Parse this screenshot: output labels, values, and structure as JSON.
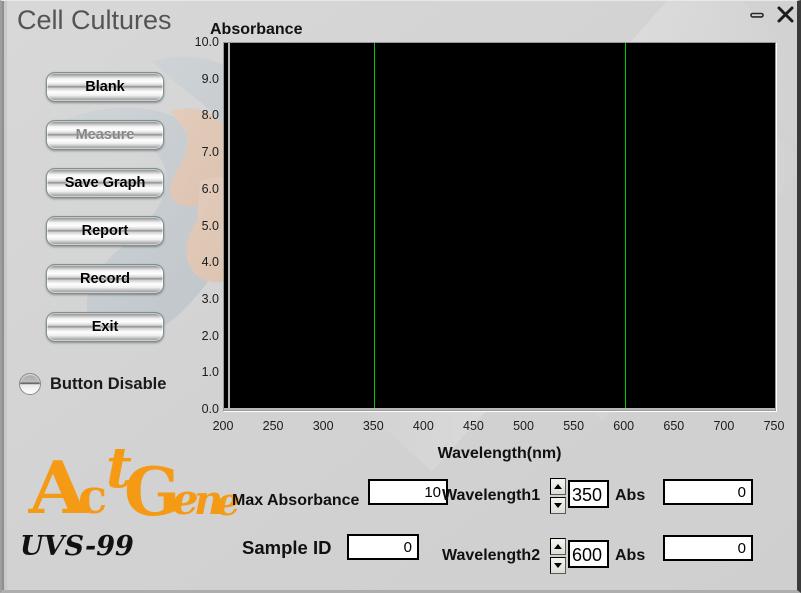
{
  "window": {
    "title": "Cell Cultures",
    "minimize_icon": "minimize-icon",
    "close_icon": "close-icon"
  },
  "sidebar": {
    "buttons": [
      {
        "label": "Blank",
        "disabled": false
      },
      {
        "label": "Measure",
        "disabled": true
      },
      {
        "label": "Save Graph",
        "disabled": false
      },
      {
        "label": "Report",
        "disabled": false
      },
      {
        "label": "Record",
        "disabled": false
      },
      {
        "label": "Exit",
        "disabled": false
      }
    ],
    "toggle": {
      "label": "Button Disable",
      "state": "off"
    },
    "logo": {
      "letters": [
        "A",
        "c",
        "t",
        "G",
        "e",
        "n",
        "e"
      ],
      "text": "AcGene",
      "model": "UVS-99",
      "color": "#f59a14"
    }
  },
  "chart_data": {
    "type": "line",
    "title": "Absorbance",
    "xlabel": "Wavelength(nm)",
    "ylabel": "Absorbance",
    "xlim": [
      200,
      750
    ],
    "ylim": [
      0.0,
      10.0
    ],
    "xticks": [
      200,
      250,
      300,
      350,
      400,
      450,
      500,
      550,
      600,
      650,
      700,
      750
    ],
    "yticks": [
      "10.0",
      "9.0",
      "8.0",
      "7.0",
      "6.0",
      "5.0",
      "4.0",
      "3.0",
      "2.0",
      "1.0",
      "0.0"
    ],
    "grid": false,
    "legend": "none",
    "plot_background": "#000000",
    "series": [
      {
        "name": "Absorbance",
        "x": [],
        "y": []
      }
    ],
    "cursors": [
      {
        "name": "wavelength1-cursor",
        "orientation": "vertical",
        "value": 350,
        "color": "#00cc00"
      },
      {
        "name": "wavelength2-cursor",
        "orientation": "vertical",
        "value": 600,
        "color": "#00cc00"
      },
      {
        "name": "x-origin-cursor",
        "orientation": "vertical",
        "value": 204,
        "color": "#b8b8b8"
      },
      {
        "name": "y-origin-cursor",
        "orientation": "horizontal",
        "value": 0.06,
        "color": "#b8b8b8"
      }
    ]
  },
  "controls": {
    "max_absorbance": {
      "label": "Max Absorbance",
      "value": "10"
    },
    "sample_id": {
      "label": "Sample ID",
      "value": "0"
    },
    "wavelength1": {
      "label": "Wavelength1",
      "value": "350",
      "abs_label": "Abs",
      "abs_value": "0"
    },
    "wavelength2": {
      "label": "Wavelength2",
      "value": "600",
      "abs_label": "Abs",
      "abs_value": "0"
    }
  }
}
